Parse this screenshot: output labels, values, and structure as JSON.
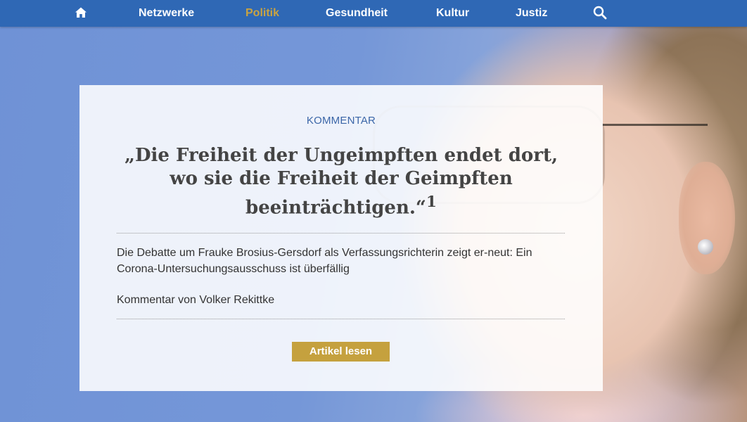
{
  "nav": {
    "home_icon": "home-icon",
    "items": [
      {
        "label": "Netzwerke",
        "active": false
      },
      {
        "label": "Politik",
        "active": true
      },
      {
        "label": "Gesundheit",
        "active": false
      },
      {
        "label": "Kultur",
        "active": false
      },
      {
        "label": "Justiz",
        "active": false
      }
    ],
    "search_icon": "search-icon",
    "colors": {
      "background": "#2f68b5",
      "active": "#c9a341",
      "text": "#ffffff"
    }
  },
  "article": {
    "kicker": "KOMMENTAR",
    "headline": "„Die Freiheit der Ungeimpften endet dort, wo sie die Freiheit der Geimpften beeinträchtigen.“",
    "footnote_mark": "1",
    "teaser": "Die Debatte um Frauke Brosius-Gersdorf als Verfassungsrichterin zeigt er-neut: Ein Corona-Untersuchungsausschuss ist überfällig",
    "author": "Kommentar von Volker Rekittke",
    "button_label": "Artikel lesen",
    "colors": {
      "kicker": "#3b66a8",
      "button": "#c5a13e"
    }
  }
}
